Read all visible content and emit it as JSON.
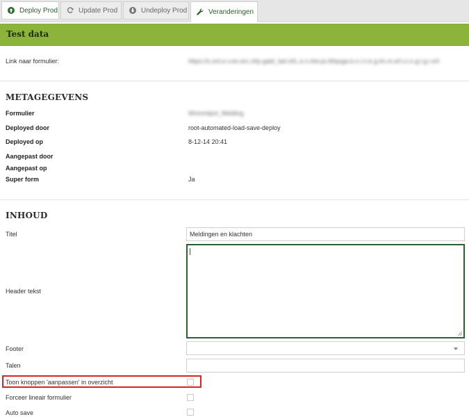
{
  "toolbar": {
    "deploy": "Deploy Prod",
    "update": "Update Prod",
    "undeploy": "Undeploy Prod",
    "changes": "Veranderingen"
  },
  "header": {
    "title": "Test data"
  },
  "link": {
    "label": "Link naar formulier:",
    "value": "https://s.onl.e.v.eo.erc.nl/p.gaid_lad.nl/L.e.n.t/ev.jo.tl/tqvga.b.n.l.n.k.g.t/s.m.e/l.v.i.n.g.l.g.r.e/t"
  },
  "meta": {
    "heading": "METAGEGEVENS",
    "formulier_label": "Formulier",
    "formulier_value": "Wnmmtpvt_Melding",
    "deployed_door_label": "Deployed door",
    "deployed_door_value": "root-automated-load-save-deploy",
    "deployed_op_label": "Deployed op",
    "deployed_op_value": "8-12-14 20:41",
    "aangepast_door_label": "Aangepast door",
    "aangepast_op_label": "Aangepast op",
    "super_form_label": "Super form",
    "super_form_value": "Ja"
  },
  "inhoud": {
    "heading": "INHOUD",
    "titel_label": "Titel",
    "titel_value": "Meldingen en klachten",
    "header_label": "Header tekst",
    "footer_label": "Footer",
    "talen_label": "Talen",
    "toon_label": "Toon knoppen 'aanpassen' in overzicht",
    "forceer_label": "Forceer lineair formulier",
    "auto_label": "Auto save"
  },
  "colors": {
    "accent": "#8cb33a",
    "highlight": "#d6261f"
  }
}
